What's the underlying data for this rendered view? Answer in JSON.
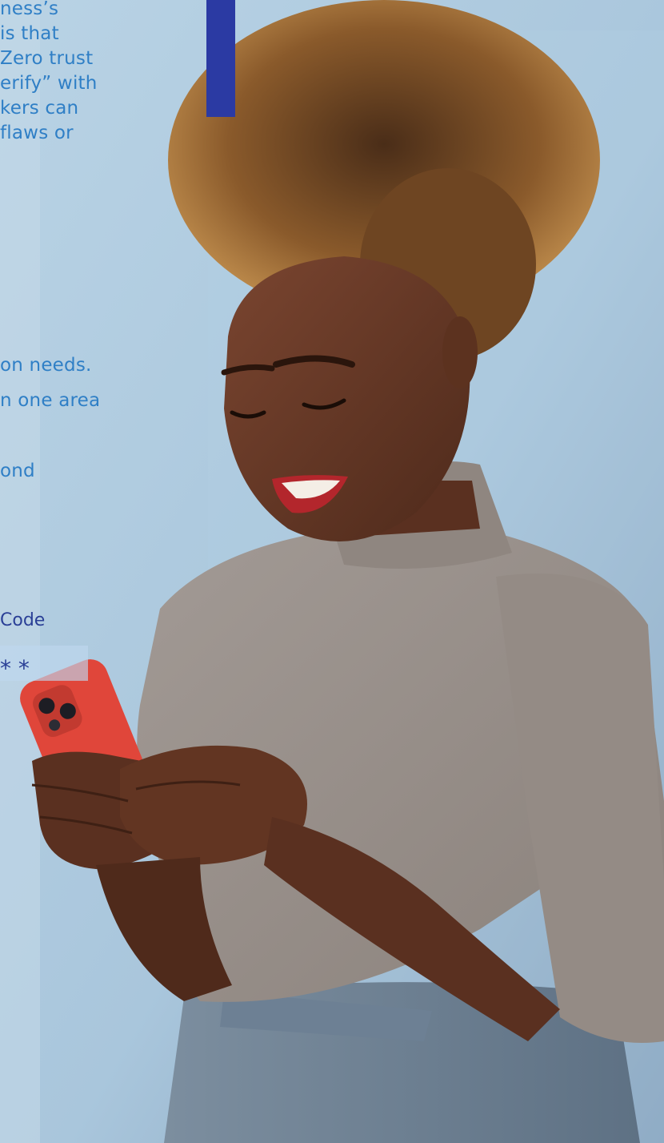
{
  "article": {
    "top_lines": [
      "ness’s",
      "is that",
      "Zero trust",
      "erify” with",
      "kers can",
      "flaws or"
    ],
    "mid_lines": [
      "on needs.",
      "n one area",
      "",
      "ond"
    ]
  },
  "login": {
    "code_label": "Code",
    "code_value": "* *"
  },
  "colors": {
    "accent": "#2b3aa3",
    "body_text": "#2f7fc6",
    "label_text": "#2a3f96",
    "background": "#b5cfe0"
  }
}
